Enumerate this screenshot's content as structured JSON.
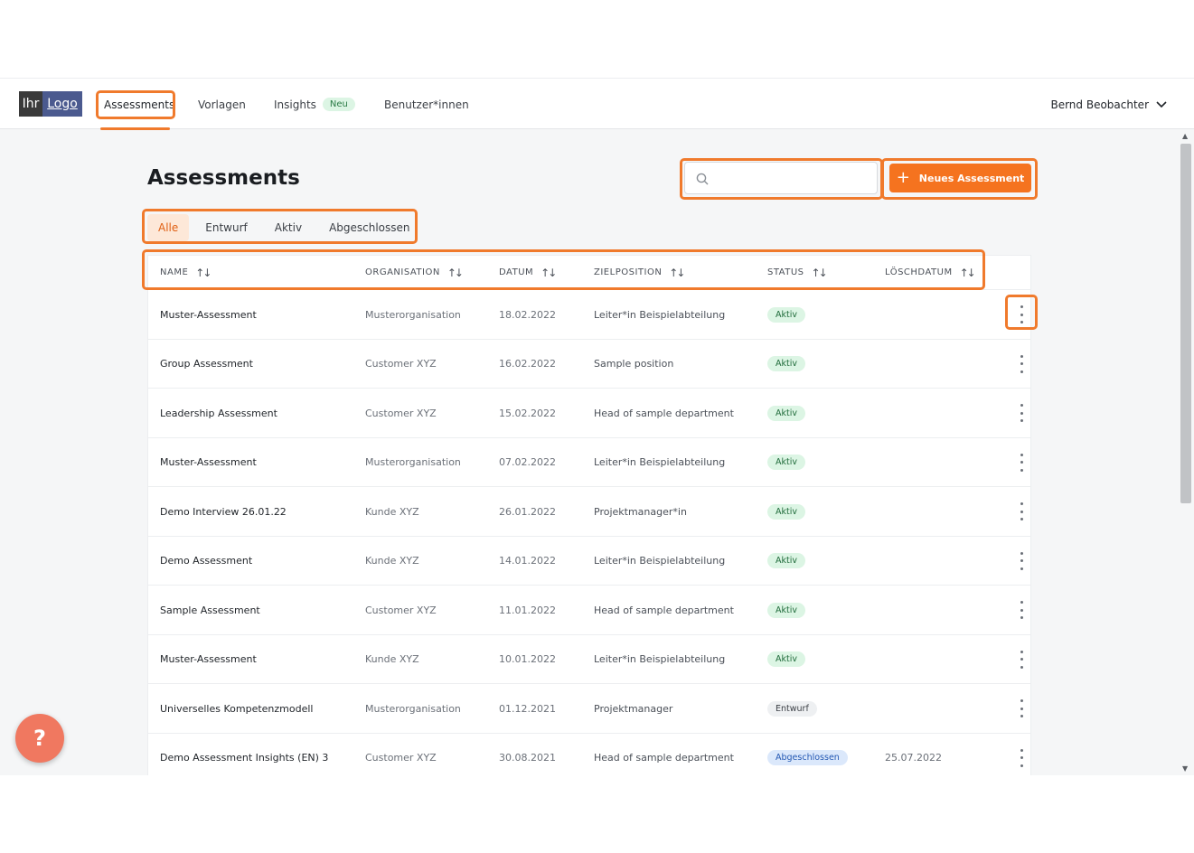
{
  "logo": {
    "part1": "Ihr",
    "part2": "Logo"
  },
  "nav": {
    "items": [
      {
        "label": "Assessments"
      },
      {
        "label": "Vorlagen"
      },
      {
        "label": "Insights",
        "badge": "Neu"
      },
      {
        "label": "Benutzer*innen"
      }
    ]
  },
  "user": {
    "name": "Bernd Beobachter"
  },
  "page": {
    "title": "Assessments"
  },
  "search": {
    "placeholder": ""
  },
  "actions": {
    "new_assessment": "Neues Assessment"
  },
  "filters": [
    "Alle",
    "Entwurf",
    "Aktiv",
    "Abgeschlossen"
  ],
  "table": {
    "columns": [
      "NAME",
      "ORGANISATION",
      "DATUM",
      "ZIELPOSITION",
      "STATUS",
      "LÖSCHDATUM"
    ],
    "rows": [
      {
        "name": "Muster-Assessment",
        "org": "Musterorganisation",
        "date": "18.02.2022",
        "position": "Leiter*in Beispielabteilung",
        "status": "Aktiv",
        "delete_date": ""
      },
      {
        "name": "Group Assessment",
        "org": "Customer XYZ",
        "date": "16.02.2022",
        "position": "Sample position",
        "status": "Aktiv",
        "delete_date": ""
      },
      {
        "name": "Leadership Assessment",
        "org": "Customer XYZ",
        "date": "15.02.2022",
        "position": "Head of sample department",
        "status": "Aktiv",
        "delete_date": ""
      },
      {
        "name": "Muster-Assessment",
        "org": "Musterorganisation",
        "date": "07.02.2022",
        "position": "Leiter*in Beispielabteilung",
        "status": "Aktiv",
        "delete_date": ""
      },
      {
        "name": "Demo Interview 26.01.22",
        "org": "Kunde XYZ",
        "date": "26.01.2022",
        "position": "Projektmanager*in",
        "status": "Aktiv",
        "delete_date": ""
      },
      {
        "name": "Demo Assessment",
        "org": "Kunde XYZ",
        "date": "14.01.2022",
        "position": "Leiter*in Beispielabteilung",
        "status": "Aktiv",
        "delete_date": ""
      },
      {
        "name": "Sample Assessment",
        "org": "Customer XYZ",
        "date": "11.01.2022",
        "position": "Head of sample department",
        "status": "Aktiv",
        "delete_date": ""
      },
      {
        "name": "Muster-Assessment",
        "org": "Kunde XYZ",
        "date": "10.01.2022",
        "position": "Leiter*in Beispielabteilung",
        "status": "Aktiv",
        "delete_date": ""
      },
      {
        "name": "Universelles Kompetenzmodell",
        "org": "Musterorganisation",
        "date": "01.12.2021",
        "position": "Projektmanager",
        "status": "Entwurf",
        "delete_date": ""
      },
      {
        "name": "Demo Assessment Insights (EN) 3",
        "org": "Customer XYZ",
        "date": "30.08.2021",
        "position": "Head of sample department",
        "status": "Abgeschlossen",
        "delete_date": "25.07.2022"
      }
    ]
  },
  "help": {
    "label": "?"
  },
  "colors": {
    "accent": "#f5731f",
    "highlight": "#f07a2c",
    "aktiv_bg": "#dcf5e4",
    "abgeschlossen_bg": "#dbe8fb"
  }
}
